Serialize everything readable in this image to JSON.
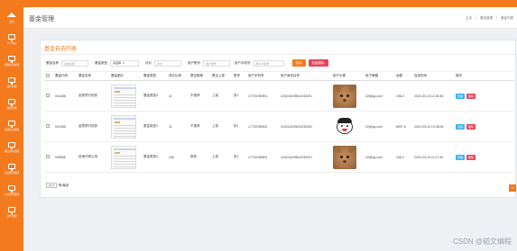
{
  "app": {
    "accent_color": "#f37b1d"
  },
  "sidebar": {
    "items": [
      {
        "label": "主页",
        "icon": "home-icon"
      },
      {
        "label": "个人中心",
        "icon": "monitor-icon"
      },
      {
        "label": "招聘信息管理",
        "icon": "monitor-icon"
      },
      {
        "label": "用户管理",
        "icon": "monitor-icon"
      },
      {
        "label": "基金管理",
        "icon": "monitor-icon"
      },
      {
        "label": "基金信息管理",
        "icon": "monitor-icon"
      },
      {
        "label": "基金评价管理",
        "icon": "monitor-icon"
      },
      {
        "label": "基金类型管理",
        "icon": "monitor-icon"
      },
      {
        "label": "公告资讯管理",
        "icon": "monitor-icon"
      },
      {
        "label": "用户管理",
        "icon": "monitor-icon"
      }
    ]
  },
  "header": {
    "title": "基金管理",
    "breadcrumb": [
      "主页",
      "基金管理",
      "基金列表"
    ]
  },
  "card": {
    "title": "基金自选列表"
  },
  "filters": {
    "fund_name_label": "基金名称",
    "fund_name_placeholder": "基金名称",
    "fund_type_label": "基金类型",
    "fund_type_value": "请选择",
    "rating_label": "评价",
    "rating_placeholder": "评价",
    "account_label": "用户账号",
    "account_placeholder": "用户账号",
    "phone_label": "用户手机号",
    "phone_placeholder": "用户手机号",
    "search_button": "查询",
    "batch_delete_button": "批量删除"
  },
  "table": {
    "headers": [
      "",
      "基金代码",
      "基金名称",
      "基金图片",
      "基金类型",
      "成长比例",
      "是否推荐",
      "是否上架",
      "账号",
      "用户手机号",
      "用户身份证号",
      "用户头像",
      "电子邮箱",
      "余额",
      "自选时间",
      "操作"
    ],
    "rows": [
      {
        "code": "004455",
        "name": "金泰预付债券",
        "type": "基金类型3",
        "ratio": "11",
        "recommended": "不推荐",
        "listed": "上架",
        "account": "张1",
        "phone": "17703786901",
        "idcard": "410224199610232001",
        "avatar": "cat",
        "email": "22@qq.com",
        "balance": "108.2",
        "time": "2022-03-10 11:35:45"
      },
      {
        "code": "004455",
        "name": "金泰预付债券",
        "type": "基金类型3",
        "ratio": "11",
        "recommended": "不推荐",
        "listed": "上架",
        "account": "张1",
        "phone": "17703786902",
        "idcard": "410224199610232002",
        "avatar": "cartoon",
        "email": "22@qq.com",
        "balance": "8097.6",
        "time": "2022-03-10 10:38:39"
      },
      {
        "code": "005655",
        "name": "前海开源公用",
        "type": "基金类型4",
        "ratio": "136",
        "recommended": "推荐",
        "listed": "上架",
        "account": "张1",
        "phone": "17703786901",
        "idcard": "410224199610232001",
        "avatar": "cat",
        "email": "22@qq.com",
        "balance": "108.2",
        "time": "2022-03-10 11:17:40"
      }
    ],
    "view_label": "查看",
    "delete_label": "删除"
  },
  "pager": {
    "page_size": "10",
    "per_page_label": "条/每页",
    "current_page": "1"
  },
  "watermark": "CSDN @韬文编程"
}
